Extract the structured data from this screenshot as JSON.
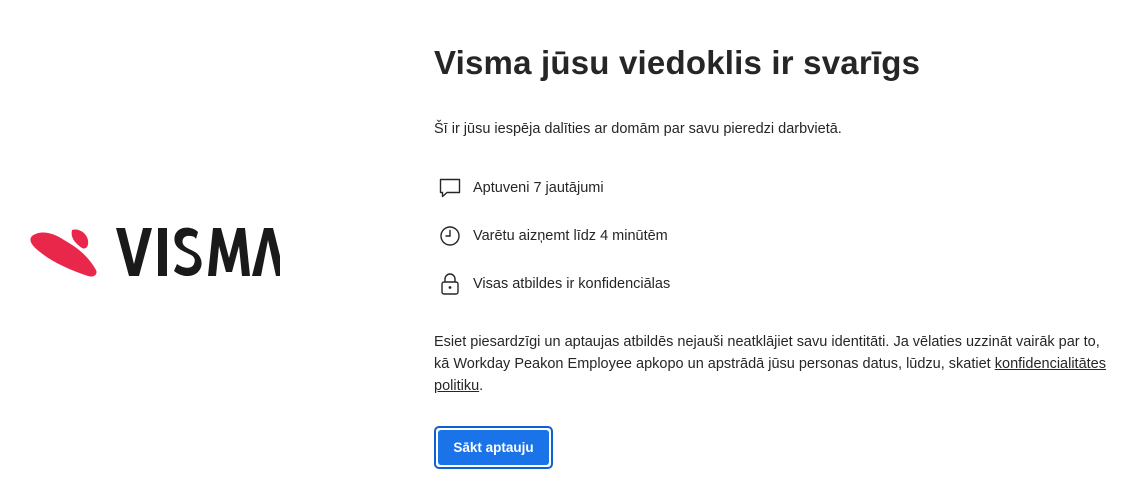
{
  "logo": {
    "text": "VISMA",
    "brand_red": "#e8274b",
    "brand_dark": "#1a1a1a"
  },
  "survey": {
    "title": "Visma jūsu viedoklis ir svarīgs",
    "intro": "Šī ir jūsu iespēja dalīties ar domām par savu pieredzi darbvietā.",
    "info_items": [
      {
        "icon": "chat-bubble-icon",
        "label": "Aptuveni 7 jautājumi"
      },
      {
        "icon": "clock-icon",
        "label": "Varētu aizņemt līdz 4 minūtēm"
      },
      {
        "icon": "lock-icon",
        "label": "Visas atbildes ir konfidenciālas"
      }
    ],
    "disclaimer_text": "Esiet piesardzīgi un aptaujas atbildēs nejauši neatklājiet savu identitāti. Ja vēlaties uzzināt vairāk par to, kā Workday Peakon Employee apkopo un apstrādā jūsu personas datus, lūdzu, skatiet ",
    "privacy_link": "konfidencialitātes politiku",
    "disclaimer_end": ".",
    "start_button": "Sākt aptauju",
    "accent_color": "#1a73e8"
  }
}
